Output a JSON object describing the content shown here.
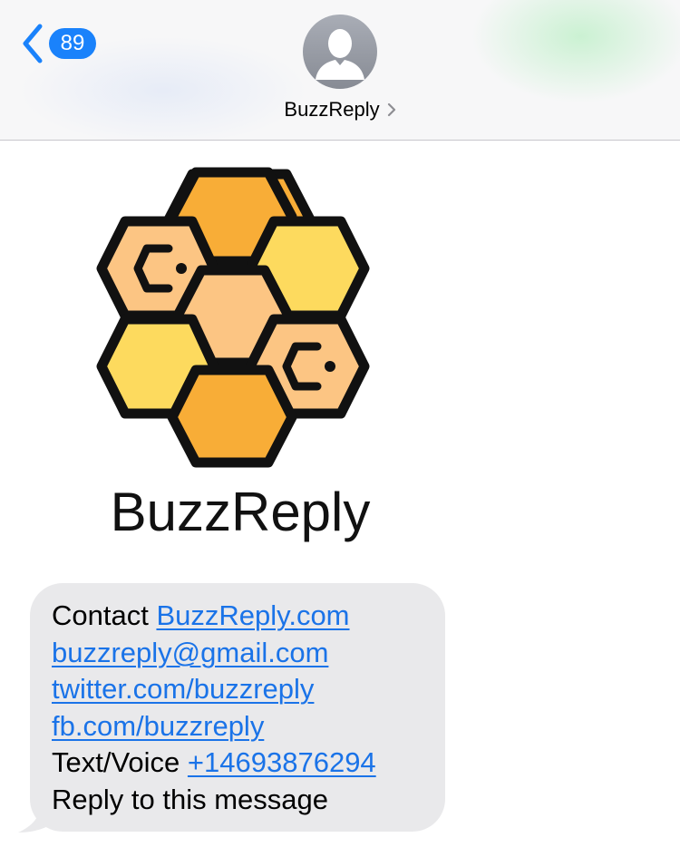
{
  "header": {
    "back_count": "89",
    "contact_name": "BuzzReply"
  },
  "logo": {
    "brand_name": "BuzzReply",
    "colors": {
      "outline": "#111111",
      "orange": "#f8ad37",
      "yellow": "#fdda5e",
      "peach": "#fcc583"
    }
  },
  "message": {
    "contact_label": "Contact ",
    "website": "BuzzReply.com",
    "email": "buzzreply@gmail.com",
    "twitter": "twitter.com/buzzreply",
    "facebook": "fb.com/buzzreply",
    "text_voice_label": "Text/Voice ",
    "phone": "+14693876294",
    "reply_text": "Reply to this message"
  },
  "colors": {
    "accent": "#1a82fb",
    "bubble": "#e9e9eb",
    "link": "#1a73e8"
  }
}
